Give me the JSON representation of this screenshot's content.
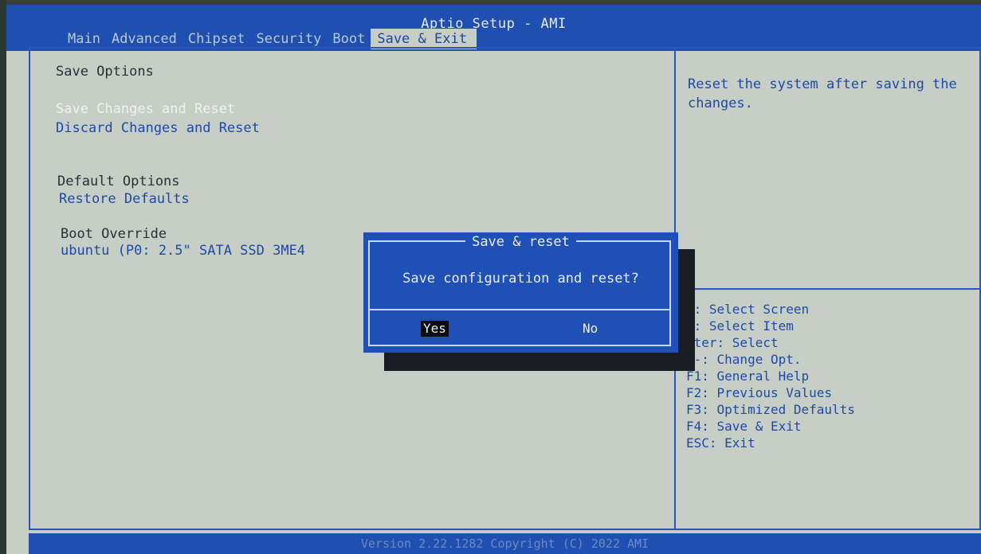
{
  "window": {
    "title": "Aptio Setup - AMI"
  },
  "tabs": [
    {
      "label": "Main"
    },
    {
      "label": "Advanced"
    },
    {
      "label": "Chipset"
    },
    {
      "label": "Security"
    },
    {
      "label": "Boot"
    },
    {
      "label": "Save & Exit",
      "active": true
    }
  ],
  "left_panel": {
    "save_options": {
      "heading": "Save Options",
      "items": [
        "Save Changes and Reset",
        "Discard Changes and Reset"
      ]
    },
    "default_options": {
      "heading": "Default Options",
      "items": [
        "Restore Defaults"
      ]
    },
    "boot_override": {
      "heading": "Boot Override",
      "items": [
        "ubuntu (P0: 2.5\" SATA SSD 3ME4"
      ]
    }
  },
  "help": {
    "description": "Reset the system after saving the changes.",
    "keys": [
      "←: Select Screen",
      "↓: Select Item",
      "nter: Select",
      "/-: Change Opt.",
      "F1: General Help",
      "F2: Previous Values",
      "F3: Optimized Defaults",
      "F4: Save & Exit",
      "ESC: Exit"
    ]
  },
  "dialog": {
    "title": "Save & reset",
    "message": "Save configuration and reset?",
    "yes_label": "Yes",
    "no_label": "No"
  },
  "footer": {
    "text": "Version 2.22.1282 Copyright (C) 2022 AMI"
  },
  "colors": {
    "header_blue": "#1f4fb0",
    "body_grey": "#c6cec6",
    "text_blue": "#1d4aa8",
    "dialog_blue": "#1f50b5"
  }
}
